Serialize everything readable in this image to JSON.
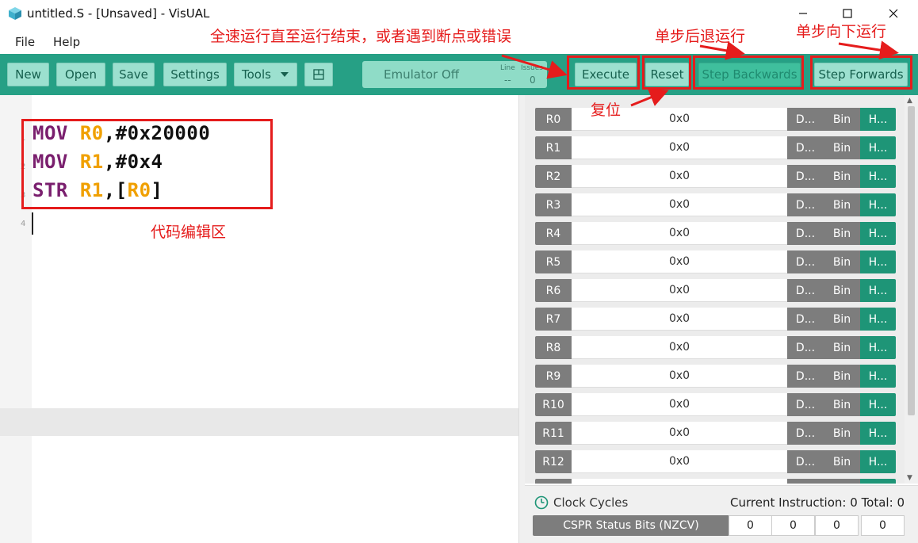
{
  "window": {
    "title": "untitled.S - [Unsaved] - VisUAL",
    "icon": "cube-icon",
    "controls": [
      "minimize-icon",
      "maximize-icon",
      "close-icon"
    ]
  },
  "menu": [
    "File",
    "Help"
  ],
  "toolbar": {
    "new": "New",
    "open": "Open",
    "save": "Save",
    "settings": "Settings",
    "tools": "Tools",
    "emulator_status": "Emulator Off",
    "line_label": "Line",
    "line_value": "--",
    "issues_label": "Issues",
    "issues_value": "0",
    "execute": "Execute",
    "reset": "Reset",
    "step_backwards": "Step Backwards",
    "step_forwards": "Step Forwards"
  },
  "editor": {
    "line_numbers": [
      "1",
      "2",
      "3",
      "4"
    ],
    "lines": [
      {
        "op": "MOV",
        "reg": "R0",
        "rest": ",#0x20000"
      },
      {
        "op": "MOV",
        "reg": "R1",
        "rest": ",#0x4"
      },
      {
        "op": "STR",
        "reg": "R1",
        "open": ",[",
        "reg2": "R0",
        "close": "]"
      }
    ]
  },
  "registers": [
    {
      "name": "R0",
      "value": "0x0"
    },
    {
      "name": "R1",
      "value": "0x0"
    },
    {
      "name": "R2",
      "value": "0x0"
    },
    {
      "name": "R3",
      "value": "0x0"
    },
    {
      "name": "R4",
      "value": "0x0"
    },
    {
      "name": "R5",
      "value": "0x0"
    },
    {
      "name": "R6",
      "value": "0x0"
    },
    {
      "name": "R7",
      "value": "0x0"
    },
    {
      "name": "R8",
      "value": "0x0"
    },
    {
      "name": "R9",
      "value": "0x0"
    },
    {
      "name": "R10",
      "value": "0x0"
    },
    {
      "name": "R11",
      "value": "0x0"
    },
    {
      "name": "R12",
      "value": "0x0"
    }
  ],
  "register_format_buttons": {
    "dec": "D...",
    "bin": "Bin",
    "hex": "H..."
  },
  "status": {
    "clock_cycles": "Clock Cycles",
    "current_instruction_label": "Current Instruction:",
    "current_instruction": "0",
    "total_label": "Total:",
    "total": "0",
    "cspr_label": "CSPR Status Bits (NZCV)",
    "flags": [
      "0",
      "0",
      "0",
      "0"
    ]
  },
  "annotations": {
    "execute_note": "全速运行直至运行结束，或者遇到断点或错误",
    "step_back_note": "单步后退运行",
    "step_forward_note": "单步向下运行",
    "reset_note": "复位",
    "editor_note": "代码编辑区"
  },
  "colors": {
    "toolbar": "#26a085",
    "button": "#9ce0cf",
    "keyword": "#7a1f6e",
    "register": "#f0a000",
    "annotation": "#e51c1c",
    "hex_active": "#1e9577"
  }
}
